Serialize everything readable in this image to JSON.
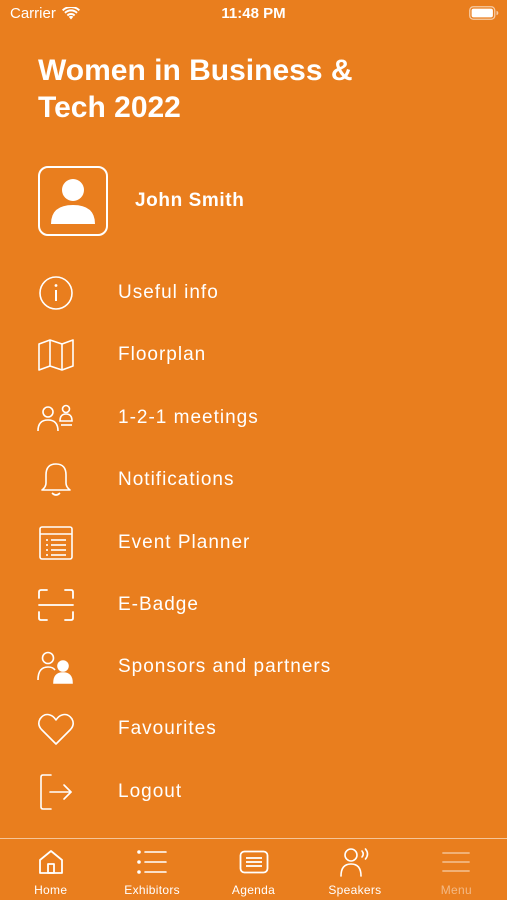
{
  "status_bar": {
    "carrier": "Carrier",
    "time": "11:48 PM"
  },
  "app_title": "Women in Business & Tech 2022",
  "profile": {
    "name": "John Smith",
    "icon": "user-icon"
  },
  "menu": {
    "items": [
      {
        "label": "Useful info",
        "icon": "info-icon"
      },
      {
        "label": "Floorplan",
        "icon": "map-icon"
      },
      {
        "label": "1-2-1 meetings",
        "icon": "meetings-icon"
      },
      {
        "label": "Notifications",
        "icon": "bell-icon"
      },
      {
        "label": "Event Planner",
        "icon": "planner-icon"
      },
      {
        "label": "E-Badge",
        "icon": "scan-icon"
      },
      {
        "label": "Sponsors and partners",
        "icon": "sponsors-icon"
      },
      {
        "label": "Favourites",
        "icon": "heart-icon"
      },
      {
        "label": "Logout",
        "icon": "logout-icon"
      }
    ]
  },
  "tab_bar": {
    "tabs": [
      {
        "label": "Home",
        "icon": "home-icon"
      },
      {
        "label": "Exhibitors",
        "icon": "list-icon"
      },
      {
        "label": "Agenda",
        "icon": "agenda-icon"
      },
      {
        "label": "Speakers",
        "icon": "speaker-icon"
      },
      {
        "label": "Menu",
        "icon": "hamburger-icon"
      }
    ]
  },
  "colors": {
    "background": "#E97E1E",
    "foreground": "#FFFFFF"
  }
}
